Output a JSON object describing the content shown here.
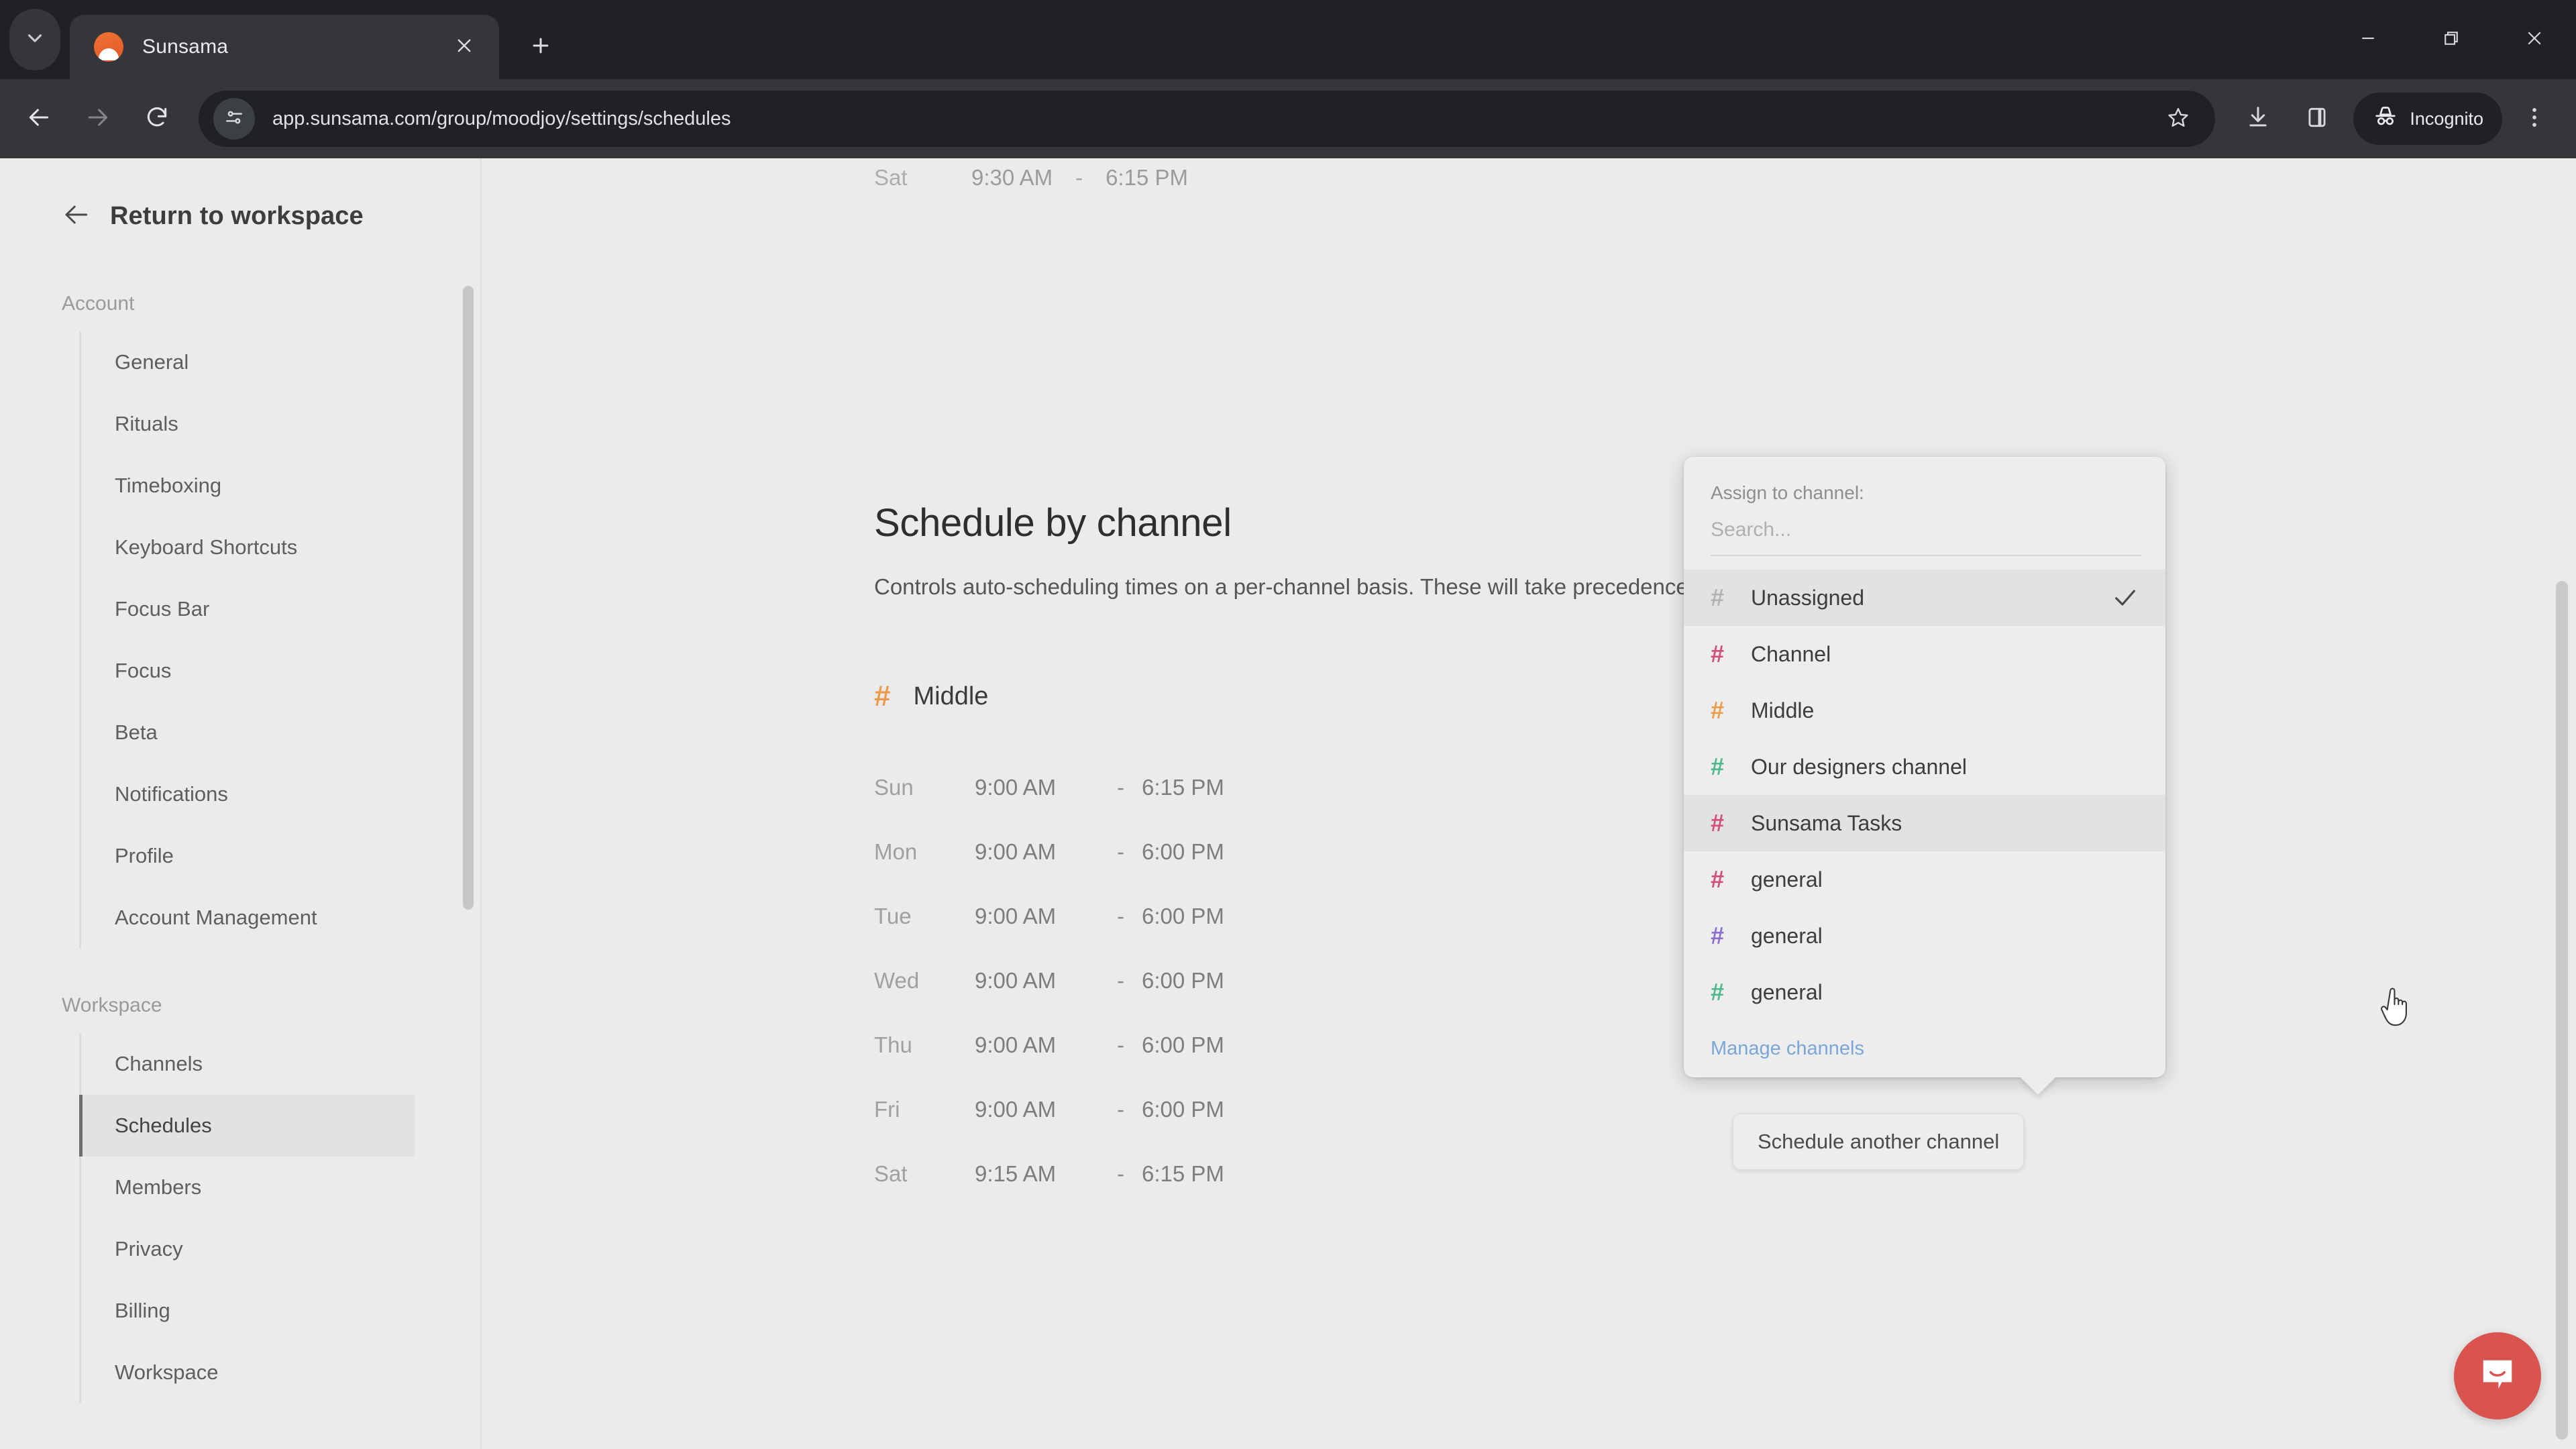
{
  "browser": {
    "tab": {
      "title": "Sunsama",
      "favicon_icon": "sunsama-favicon"
    },
    "tab_list_icon": "chevron-down-icon",
    "close_tab_icon": "close-icon",
    "new_tab_icon": "plus-icon",
    "window": {
      "minimize_icon": "minimize-icon",
      "maximize_icon": "restore-icon",
      "close_icon": "close-icon"
    },
    "toolbar": {
      "back_icon": "back-arrow-icon",
      "forward_icon": "forward-arrow-icon",
      "reload_icon": "reload-icon",
      "site_info_icon": "tune-sliders-icon",
      "url": "app.sunsama.com/group/moodjoy/settings/schedules",
      "bookmark_icon": "star-icon",
      "downloads_icon": "download-icon",
      "side_panel_icon": "side-panel-icon",
      "incognito_label": "Incognito",
      "incognito_icon": "incognito-hat-icon",
      "menu_icon": "three-dot-menu-icon"
    }
  },
  "sidebar": {
    "return_label": "Return to workspace",
    "return_icon": "back-arrow-icon",
    "sections": [
      {
        "label": "Account",
        "items": [
          {
            "label": "General",
            "active": false
          },
          {
            "label": "Rituals",
            "active": false
          },
          {
            "label": "Timeboxing",
            "active": false
          },
          {
            "label": "Keyboard Shortcuts",
            "active": false
          },
          {
            "label": "Focus Bar",
            "active": false
          },
          {
            "label": "Focus",
            "active": false
          },
          {
            "label": "Beta",
            "active": false
          },
          {
            "label": "Notifications",
            "active": false
          },
          {
            "label": "Profile",
            "active": false
          },
          {
            "label": "Account Management",
            "active": false
          }
        ]
      },
      {
        "label": "Workspace",
        "items": [
          {
            "label": "Channels",
            "active": false
          },
          {
            "label": "Schedules",
            "active": true
          },
          {
            "label": "Members",
            "active": false
          },
          {
            "label": "Privacy",
            "active": false
          },
          {
            "label": "Billing",
            "active": false
          },
          {
            "label": "Workspace",
            "active": false
          }
        ]
      }
    ]
  },
  "main": {
    "partial_row": {
      "day": "Sat",
      "start": "9:30 AM",
      "dash": "-",
      "end": "6:15 PM"
    },
    "title": "Schedule by channel",
    "subtitle": "Controls auto-scheduling times on a per-channel basis. These will take precedence over your defaults.",
    "channel": {
      "hash": "#",
      "name": "Middle",
      "hash_color": "#eb9b4c"
    },
    "schedule_rows": [
      {
        "day": "Sun",
        "start": "9:00 AM",
        "dash": "-",
        "end": "6:15 PM"
      },
      {
        "day": "Mon",
        "start": "9:00 AM",
        "dash": "-",
        "end": "6:00 PM"
      },
      {
        "day": "Tue",
        "start": "9:00 AM",
        "dash": "-",
        "end": "6:00 PM"
      },
      {
        "day": "Wed",
        "start": "9:00 AM",
        "dash": "-",
        "end": "6:00 PM"
      },
      {
        "day": "Thu",
        "start": "9:00 AM",
        "dash": "-",
        "end": "6:00 PM"
      },
      {
        "day": "Fri",
        "start": "9:00 AM",
        "dash": "-",
        "end": "6:00 PM"
      },
      {
        "day": "Sat",
        "start": "9:15 AM",
        "dash": "-",
        "end": "6:15 PM"
      }
    ],
    "schedule_another_button": "Schedule another channel"
  },
  "dropdown": {
    "label": "Assign to channel:",
    "search_placeholder": "Search...",
    "search_value": "",
    "manage_link": "Manage channels",
    "items": [
      {
        "hash": "#",
        "label": "Unassigned",
        "color": "#b3b3b3",
        "selected": true,
        "highlight": true
      },
      {
        "hash": "#",
        "label": "Channel",
        "color": "#d04f7e",
        "selected": false,
        "highlight": false
      },
      {
        "hash": "#",
        "label": "Middle",
        "color": "#eb9b4c",
        "selected": false,
        "highlight": false
      },
      {
        "hash": "#",
        "label": "Our designers channel",
        "color": "#4fb98a",
        "selected": false,
        "highlight": false
      },
      {
        "hash": "#",
        "label": "Sunsama Tasks",
        "color": "#d04f7e",
        "selected": false,
        "highlight": true
      },
      {
        "hash": "#",
        "label": "general",
        "color": "#d04f7e",
        "selected": false,
        "highlight": false
      },
      {
        "hash": "#",
        "label": "general",
        "color": "#8b6fd0",
        "selected": false,
        "highlight": false
      },
      {
        "hash": "#",
        "label": "general",
        "color": "#4fb98a",
        "selected": false,
        "highlight": false
      }
    ],
    "check_icon": "checkmark-icon"
  },
  "widgets": {
    "intercom_icon": "intercom-chat-icon",
    "intercom_color": "#d9534f"
  }
}
